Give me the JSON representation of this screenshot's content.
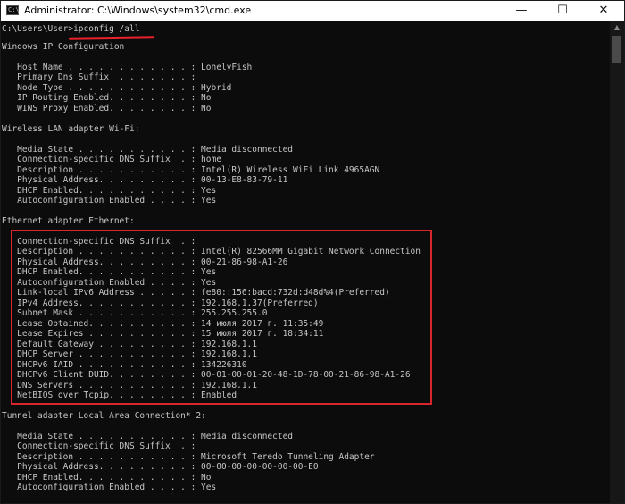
{
  "window": {
    "title": "Administrator: C:\\Windows\\system32\\cmd.exe",
    "icon_label": "C:\\",
    "minimize_glyph": "—",
    "maximize_glyph": "☐",
    "close_glyph": "✕"
  },
  "scrollbar": {
    "up_glyph": "▲"
  },
  "console": {
    "lines": [
      "C:\\Users\\User>ipconfig /all",
      "Windows IP Configuration",
      "",
      "   Host Name . . . . . . . . . . . . : LonelyFish",
      "   Primary Dns Suffix  . . . . . . . :",
      "   Node Type . . . . . . . . . . . . : Hybrid",
      "   IP Routing Enabled. . . . . . . . : No",
      "   WINS Proxy Enabled. . . . . . . . : No",
      "",
      "Wireless LAN adapter Wi-Fi:",
      "",
      "   Media State . . . . . . . . . . . : Media disconnected",
      "   Connection-specific DNS Suffix  . : home",
      "   Description . . . . . . . . . . . : Intel(R) Wireless WiFi Link 4965AGN",
      "   Physical Address. . . . . . . . . : 00-13-E8-83-79-11",
      "   DHCP Enabled. . . . . . . . . . . : Yes",
      "   Autoconfiguration Enabled . . . . : Yes",
      "",
      "Ethernet adapter Ethernet:",
      "",
      "   Connection-specific DNS Suffix  . :",
      "   Description . . . . . . . . . . . : Intel(R) 82566MM Gigabit Network Connection",
      "   Physical Address. . . . . . . . . : 00-21-86-98-A1-26",
      "   DHCP Enabled. . . . . . . . . . . : Yes",
      "   Autoconfiguration Enabled . . . . : Yes",
      "   Link-local IPv6 Address . . . . . : fe80::156:bacd:732d:d48d%4(Preferred)",
      "   IPv4 Address. . . . . . . . . . . : 192.168.1.37(Preferred)",
      "   Subnet Mask . . . . . . . . . . . : 255.255.255.0",
      "   Lease Obtained. . . . . . . . . . : 14 июля 2017 г. 11:35:49",
      "   Lease Expires . . . . . . . . . . : 15 июля 2017 г. 18:34:11",
      "   Default Gateway . . . . . . . . . : 192.168.1.1",
      "   DHCP Server . . . . . . . . . . . : 192.168.1.1",
      "   DHCPv6 IAID . . . . . . . . . . . : 134226310",
      "   DHCPv6 Client DUID. . . . . . . . : 00-01-00-01-20-48-1D-78-00-21-86-98-A1-26",
      "   DNS Servers . . . . . . . . . . . : 192.168.1.1",
      "   NetBIOS over Tcpip. . . . . . . . : Enabled",
      "",
      "Tunnel adapter Local Area Connection* 2:",
      "",
      "   Media State . . . . . . . . . . . : Media disconnected",
      "   Connection-specific DNS Suffix  . :",
      "   Description . . . . . . . . . . . : Microsoft Teredo Tunneling Adapter",
      "   Physical Address. . . . . . . . . : 00-00-00-00-00-00-00-E0",
      "   DHCP Enabled. . . . . . . . . . . : No",
      "   Autoconfiguration Enabled . . . . : Yes"
    ]
  },
  "annotations": {
    "underline_color": "#e8212a",
    "box_color": "#d9262c"
  }
}
